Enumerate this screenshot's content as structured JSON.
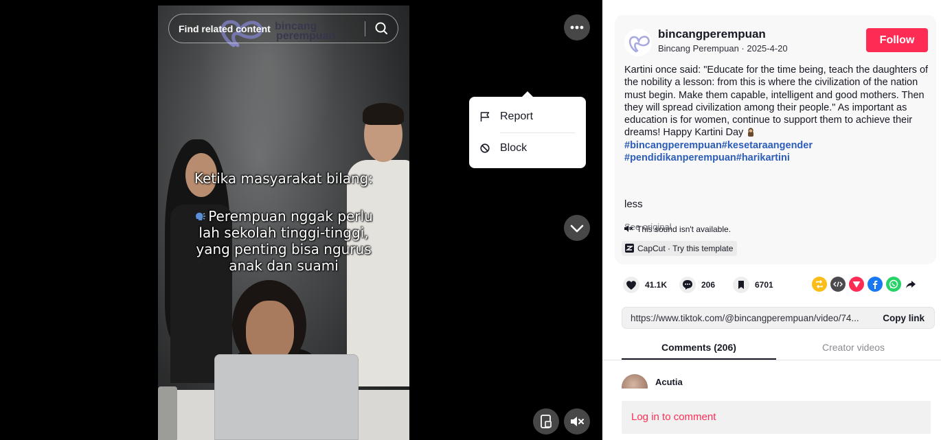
{
  "video": {
    "search_placeholder": "Find related content",
    "watermark_line1": "bincang",
    "watermark_line2": "perempuan",
    "overlay_heading": "Ketika masyarakat bilang:",
    "overlay_line1": "Perempuan nggak perlu",
    "overlay_line2": "lah sekolah tinggi-tinggi,",
    "overlay_line3": "yang penting bisa ngurus",
    "overlay_line4": "anak dan suami"
  },
  "menu": {
    "report_label": "Report",
    "block_label": "Block"
  },
  "post": {
    "author_handle": "bincangperempuan",
    "author_meta": "Bincang Perempuan · 2025-4-20",
    "follow_label": "Follow",
    "description": "Kartini once said: \"Educate for the time being, teach the daughters of the nobility a lesson: from this is where the civilization of the nation must begin. Make them capable, intelligent and good mothers. Then they will spread civilization among their people.\" As important as education is for women, continue to support them to achieve their dreams! Happy Kartini Day",
    "hashtags": "#bincangperempuan#kesetaraangender #pendidikanperempuan#harikartini",
    "less_label": "less",
    "see_original": "See original",
    "sound_text": "This sound isn't available.",
    "capcut_text": "CapCut · Try this template"
  },
  "stats": {
    "likes": "41.1K",
    "comments": "206",
    "saves": "6701"
  },
  "share": {
    "url": "https://www.tiktok.com/@bincangperempuan/video/74...",
    "copy_label": "Copy link"
  },
  "tabs": {
    "comments": "Comments (206)",
    "creator": "Creator videos"
  },
  "comments": [
    {
      "name": "Acutia"
    }
  ],
  "login_prompt": "Log in to comment",
  "colors": {
    "accent": "#fe2c55",
    "hashtag": "#2b5db9"
  }
}
